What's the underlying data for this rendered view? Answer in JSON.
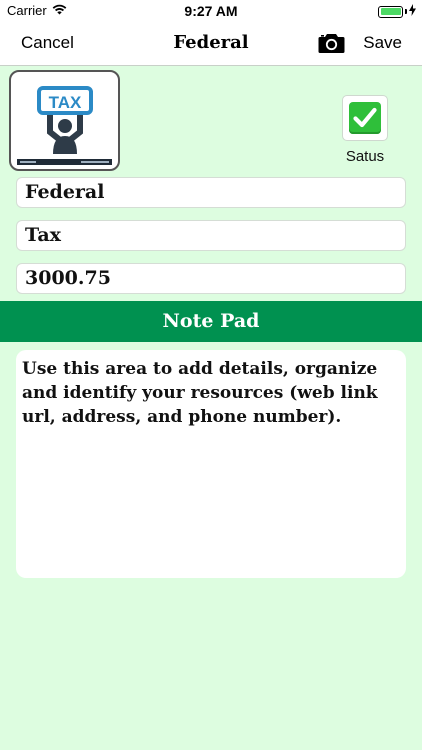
{
  "status_bar": {
    "carrier": "Carrier",
    "time": "9:27 AM"
  },
  "nav": {
    "cancel_label": "Cancel",
    "title": "Federal",
    "camera_icon": "camera-icon",
    "save_label": "Save"
  },
  "thumbnail": {
    "sign_text": "TAX",
    "icon": "person-holding-tax-sign-icon"
  },
  "status": {
    "label": "Satus",
    "checked": true,
    "icon": "green-checkmark-icon",
    "color": "#2fbf3a"
  },
  "fields": {
    "name": "Federal",
    "category": "Tax",
    "amount": "3000.75"
  },
  "notepad": {
    "header": "Note Pad",
    "header_color": "#009150",
    "text": "Use this area to add details, organize and identify your resources (web link url, address, and phone number)."
  },
  "colors": {
    "background": "#ddfde0",
    "tax_blue": "#2b8ac6"
  }
}
